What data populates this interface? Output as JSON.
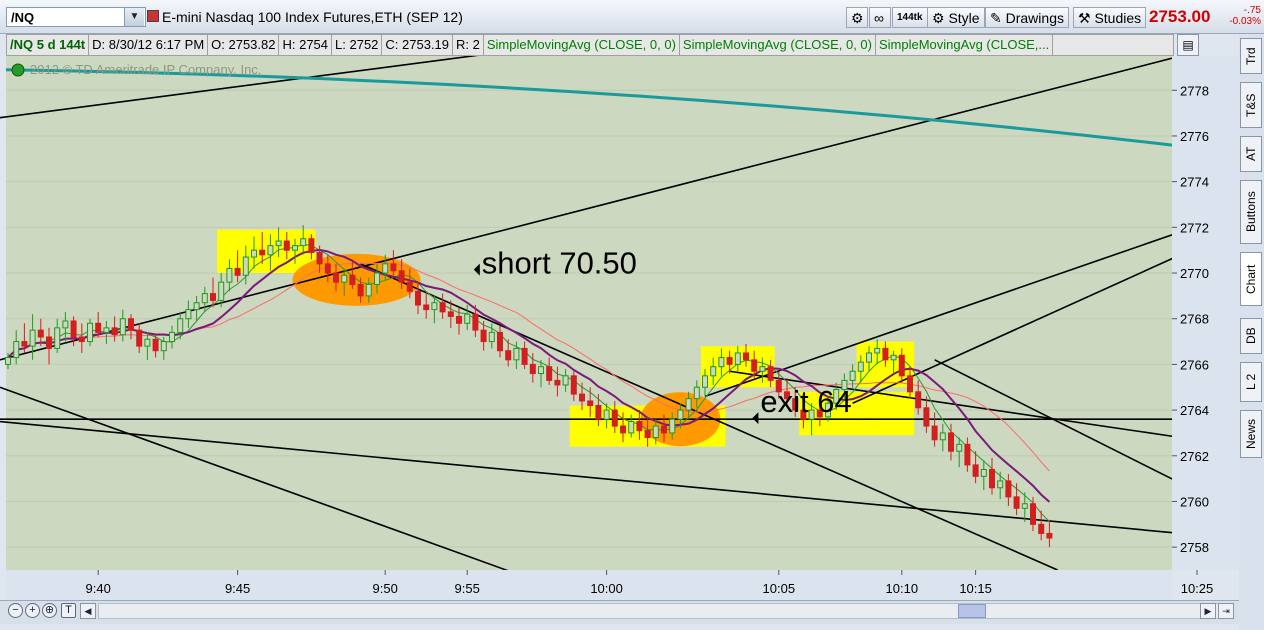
{
  "toolbar": {
    "symbol": "/NQ",
    "instrument_title": "E-mini Nasdaq 100 Index Futures,ETH (SEP 12)",
    "tick_label": "144tk",
    "style_label": "Style",
    "drawings_label": "Drawings",
    "studies_label": "Studies",
    "last_price": "2753.00",
    "change": "-.75",
    "change_pct": "-0.03%"
  },
  "infobar": {
    "symbol_period": "/NQ 5 d 144t",
    "date": "D: 8/30/12 6:17 PM",
    "open": "O: 2753.82",
    "high": "H: 2754",
    "low": "L: 2752",
    "close": "C: 2753.19",
    "range": "R: 2",
    "study1": "SimpleMovingAvg (CLOSE, 0, 0)",
    "study2": "SimpleMovingAvg (CLOSE, 0, 0)",
    "study3": "SimpleMovingAvg (CLOSE,..."
  },
  "sidebar": {
    "tabs": [
      "Trd",
      "T&S",
      "AT",
      "Buttons",
      "Chart",
      "DB",
      "L 2",
      "News"
    ]
  },
  "colors": {
    "background": "#ccd8bf",
    "up": "#1f9a1f",
    "down": "#d21f1f",
    "highlight": "#ffff00",
    "ellipse": "#ff9900",
    "teal": "#1a9a9a"
  },
  "chart_data": {
    "type": "candlestick",
    "watermark": "2012 © TD Ameritrade IP Company, Inc.",
    "ylim": [
      2757,
      2779.5
    ],
    "yticks": [
      2758,
      2760,
      2762,
      2764,
      2766,
      2768,
      2770,
      2772,
      2774,
      2776,
      2778
    ],
    "time_labels": [
      {
        "label": "9:40",
        "bar": 11
      },
      {
        "label": "9:45",
        "bar": 28
      },
      {
        "label": "9:50",
        "bar": 46
      },
      {
        "label": "9:55",
        "bar": 56
      },
      {
        "label": "10:00",
        "bar": 73
      },
      {
        "label": "10:05",
        "bar": 94
      },
      {
        "label": "10:10",
        "bar": 109
      },
      {
        "label": "10:15",
        "bar": 118
      },
      {
        "label": "10:25",
        "bar": 145
      }
    ],
    "candles": [
      [
        2766.0,
        2766.5,
        2765.8,
        2766.3
      ],
      [
        2766.3,
        2767.5,
        2766.0,
        2767.0
      ],
      [
        2767.0,
        2767.8,
        2766.5,
        2766.8
      ],
      [
        2766.8,
        2768.2,
        2766.2,
        2767.5
      ],
      [
        2767.5,
        2768.0,
        2766.8,
        2767.2
      ],
      [
        2767.2,
        2767.6,
        2766.0,
        2766.7
      ],
      [
        2766.7,
        2768.0,
        2766.5,
        2767.6
      ],
      [
        2767.6,
        2768.3,
        2767.0,
        2767.9
      ],
      [
        2767.9,
        2768.1,
        2766.8,
        2767.2
      ],
      [
        2767.2,
        2767.8,
        2766.5,
        2767.0
      ],
      [
        2767.0,
        2768.0,
        2766.8,
        2767.8
      ],
      [
        2767.8,
        2768.3,
        2767.2,
        2767.4
      ],
      [
        2767.4,
        2767.9,
        2766.9,
        2767.6
      ],
      [
        2767.6,
        2768.1,
        2767.0,
        2767.3
      ],
      [
        2767.3,
        2768.4,
        2767.0,
        2768.0
      ],
      [
        2768.0,
        2768.2,
        2767.1,
        2767.5
      ],
      [
        2767.5,
        2767.8,
        2766.5,
        2766.8
      ],
      [
        2766.8,
        2767.4,
        2766.2,
        2767.1
      ],
      [
        2767.1,
        2767.3,
        2766.3,
        2766.6
      ],
      [
        2766.6,
        2767.2,
        2766.2,
        2767.0
      ],
      [
        2767.0,
        2767.7,
        2766.7,
        2767.4
      ],
      [
        2767.4,
        2768.3,
        2767.1,
        2768.0
      ],
      [
        2768.0,
        2768.8,
        2767.6,
        2768.4
      ],
      [
        2768.4,
        2769.0,
        2767.9,
        2768.7
      ],
      [
        2768.7,
        2769.4,
        2768.3,
        2769.1
      ],
      [
        2769.1,
        2769.8,
        2768.5,
        2768.8
      ],
      [
        2768.8,
        2770.0,
        2768.5,
        2769.6
      ],
      [
        2769.6,
        2770.6,
        2769.2,
        2770.2
      ],
      [
        2770.2,
        2771.0,
        2769.6,
        2769.9
      ],
      [
        2769.9,
        2771.2,
        2769.5,
        2770.7
      ],
      [
        2770.7,
        2771.6,
        2770.2,
        2771.0
      ],
      [
        2771.0,
        2771.8,
        2770.4,
        2770.8
      ],
      [
        2770.8,
        2771.7,
        2770.1,
        2771.2
      ],
      [
        2771.2,
        2772.0,
        2770.7,
        2771.4
      ],
      [
        2771.4,
        2771.8,
        2770.6,
        2771.0
      ],
      [
        2771.0,
        2771.5,
        2770.4,
        2771.2
      ],
      [
        2771.2,
        2772.1,
        2770.8,
        2771.5
      ],
      [
        2771.5,
        2771.7,
        2770.6,
        2770.9
      ],
      [
        2770.9,
        2771.2,
        2770.0,
        2770.4
      ],
      [
        2770.4,
        2770.8,
        2769.6,
        2770.0
      ],
      [
        2770.0,
        2770.4,
        2769.2,
        2769.6
      ],
      [
        2769.6,
        2770.2,
        2769.0,
        2769.9
      ],
      [
        2769.9,
        2770.5,
        2769.3,
        2769.5
      ],
      [
        2769.5,
        2769.8,
        2768.7,
        2769.0
      ],
      [
        2769.0,
        2769.8,
        2768.7,
        2769.5
      ],
      [
        2769.5,
        2770.4,
        2769.1,
        2770.0
      ],
      [
        2770.0,
        2770.8,
        2769.7,
        2770.4
      ],
      [
        2770.4,
        2771.0,
        2769.9,
        2770.1
      ],
      [
        2770.1,
        2770.6,
        2769.3,
        2769.6
      ],
      [
        2769.6,
        2770.2,
        2768.9,
        2769.2
      ],
      [
        2769.2,
        2769.6,
        2768.2,
        2768.6
      ],
      [
        2768.6,
        2769.2,
        2768.0,
        2768.4
      ],
      [
        2768.4,
        2769.0,
        2767.8,
        2768.7
      ],
      [
        2768.7,
        2769.1,
        2768.0,
        2768.3
      ],
      [
        2768.3,
        2768.8,
        2767.6,
        2768.1
      ],
      [
        2768.1,
        2768.5,
        2767.3,
        2767.8
      ],
      [
        2767.8,
        2768.6,
        2767.5,
        2768.2
      ],
      [
        2768.2,
        2768.6,
        2767.2,
        2767.5
      ],
      [
        2767.5,
        2767.9,
        2766.6,
        2767.0
      ],
      [
        2767.0,
        2767.8,
        2766.7,
        2767.4
      ],
      [
        2767.4,
        2767.7,
        2766.3,
        2766.6
      ],
      [
        2766.6,
        2767.1,
        2765.9,
        2766.2
      ],
      [
        2766.2,
        2767.0,
        2765.8,
        2766.7
      ],
      [
        2766.7,
        2767.0,
        2765.8,
        2766.0
      ],
      [
        2766.0,
        2766.5,
        2765.2,
        2765.6
      ],
      [
        2765.6,
        2766.2,
        2765.0,
        2765.9
      ],
      [
        2765.9,
        2766.3,
        2765.1,
        2765.3
      ],
      [
        2765.3,
        2765.9,
        2764.6,
        2765.1
      ],
      [
        2765.1,
        2765.8,
        2764.8,
        2765.5
      ],
      [
        2765.5,
        2765.7,
        2764.4,
        2764.7
      ],
      [
        2764.7,
        2765.2,
        2764.0,
        2764.4
      ],
      [
        2764.4,
        2765.0,
        2763.7,
        2764.2
      ],
      [
        2764.2,
        2764.7,
        2763.3,
        2763.6
      ],
      [
        2763.6,
        2764.3,
        2763.2,
        2764.0
      ],
      [
        2764.0,
        2764.4,
        2763.0,
        2763.3
      ],
      [
        2763.3,
        2763.9,
        2762.6,
        2763.0
      ],
      [
        2763.0,
        2763.8,
        2762.8,
        2763.5
      ],
      [
        2763.5,
        2764.0,
        2762.7,
        2763.1
      ],
      [
        2763.1,
        2763.7,
        2762.4,
        2762.8
      ],
      [
        2762.8,
        2763.6,
        2762.5,
        2763.3
      ],
      [
        2763.3,
        2763.8,
        2762.6,
        2763.0
      ],
      [
        2763.0,
        2763.9,
        2762.7,
        2763.6
      ],
      [
        2763.6,
        2764.3,
        2763.2,
        2764.0
      ],
      [
        2764.0,
        2764.8,
        2763.6,
        2764.5
      ],
      [
        2764.5,
        2765.3,
        2764.1,
        2765.0
      ],
      [
        2765.0,
        2765.8,
        2764.6,
        2765.5
      ],
      [
        2765.5,
        2766.3,
        2765.1,
        2765.9
      ],
      [
        2765.9,
        2766.7,
        2765.5,
        2766.3
      ],
      [
        2766.3,
        2766.6,
        2765.6,
        2766.0
      ],
      [
        2766.0,
        2766.8,
        2765.7,
        2766.5
      ],
      [
        2766.5,
        2766.9,
        2765.9,
        2766.2
      ],
      [
        2766.2,
        2766.6,
        2765.4,
        2765.7
      ],
      [
        2765.7,
        2766.3,
        2765.2,
        2765.9
      ],
      [
        2765.9,
        2766.2,
        2765.0,
        2765.3
      ],
      [
        2765.3,
        2765.7,
        2764.5,
        2764.8
      ],
      [
        2764.8,
        2765.4,
        2764.2,
        2764.5
      ],
      [
        2764.5,
        2765.0,
        2763.7,
        2764.0
      ],
      [
        2764.0,
        2764.6,
        2763.2,
        2763.6
      ],
      [
        2763.6,
        2764.3,
        2762.9,
        2764.0
      ],
      [
        2764.0,
        2764.5,
        2763.3,
        2763.7
      ],
      [
        2763.7,
        2764.6,
        2763.5,
        2764.3
      ],
      [
        2764.3,
        2765.2,
        2764.0,
        2764.9
      ],
      [
        2764.9,
        2765.6,
        2764.5,
        2765.3
      ],
      [
        2765.3,
        2766.0,
        2764.9,
        2765.7
      ],
      [
        2765.7,
        2766.4,
        2765.2,
        2766.1
      ],
      [
        2766.1,
        2766.8,
        2765.7,
        2766.5
      ],
      [
        2766.5,
        2767.1,
        2766.0,
        2766.7
      ],
      [
        2766.7,
        2767.0,
        2765.9,
        2766.2
      ],
      [
        2766.2,
        2766.6,
        2765.6,
        2766.4
      ],
      [
        2766.4,
        2766.7,
        2765.2,
        2765.5
      ],
      [
        2765.5,
        2765.9,
        2764.5,
        2764.8
      ],
      [
        2764.8,
        2765.3,
        2763.8,
        2764.1
      ],
      [
        2764.1,
        2764.6,
        2763.0,
        2763.3
      ],
      [
        2763.3,
        2763.9,
        2762.4,
        2762.7
      ],
      [
        2762.7,
        2763.4,
        2762.2,
        2763.0
      ],
      [
        2763.0,
        2763.4,
        2761.8,
        2762.2
      ],
      [
        2762.2,
        2762.8,
        2761.5,
        2762.5
      ],
      [
        2762.5,
        2762.8,
        2761.3,
        2761.6
      ],
      [
        2761.6,
        2762.2,
        2760.8,
        2761.1
      ],
      [
        2761.1,
        2761.8,
        2760.5,
        2761.4
      ],
      [
        2761.4,
        2761.9,
        2760.3,
        2760.6
      ],
      [
        2760.6,
        2761.3,
        2760.1,
        2760.9
      ],
      [
        2760.9,
        2761.2,
        2759.8,
        2760.2
      ],
      [
        2760.2,
        2760.8,
        2759.4,
        2759.7
      ],
      [
        2759.7,
        2760.4,
        2759.1,
        2759.9
      ],
      [
        2759.9,
        2760.2,
        2758.7,
        2759.0
      ],
      [
        2759.0,
        2759.6,
        2758.3,
        2758.6
      ],
      [
        2758.6,
        2759.2,
        2758.0,
        2758.4
      ]
    ],
    "annotations": [
      {
        "text": "short 70.50",
        "bar": 59,
        "price": 2770.5
      },
      {
        "text": "exit 64",
        "bar": 92,
        "price": 2764.0
      }
    ]
  }
}
